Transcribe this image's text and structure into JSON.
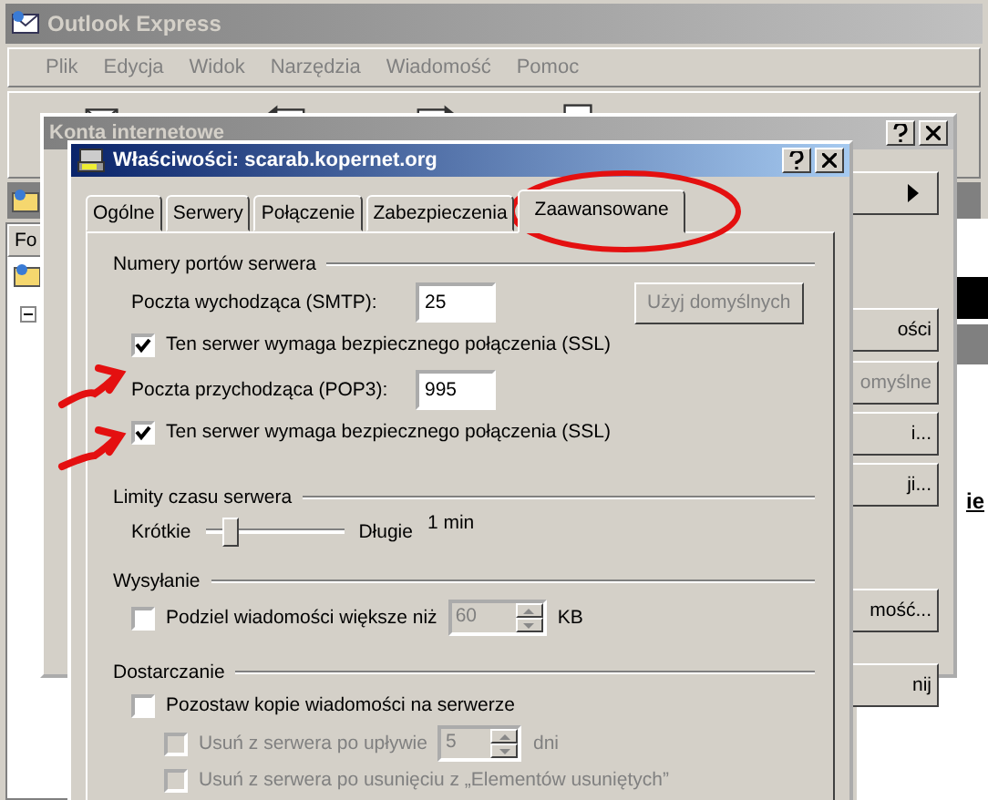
{
  "main_window": {
    "title": "Outlook Express",
    "menu": [
      "Plik",
      "Edycja",
      "Widok",
      "Narzędzia",
      "Wiadomość",
      "Pomoc"
    ],
    "folder_header": "Fo",
    "content_text": "ie"
  },
  "accounts_dialog": {
    "title": "Konta internetowe",
    "buttons": [
      {
        "label": "ości",
        "disabled": false
      },
      {
        "label": "omyślne",
        "disabled": true
      },
      {
        "label": "i...",
        "disabled": false
      },
      {
        "label": "ji...",
        "disabled": false
      },
      {
        "label": "mość...",
        "disabled": false
      },
      {
        "label": "nij",
        "disabled": false
      }
    ]
  },
  "properties_dialog": {
    "title": "Właściwości: scarab.kopernet.org",
    "tabs": [
      {
        "label": "Ogólne",
        "selected": false
      },
      {
        "label": "Serwery",
        "selected": false
      },
      {
        "label": "Połączenie",
        "selected": false
      },
      {
        "label": "Zabezpieczenia",
        "selected": false
      },
      {
        "label": "Zaawansowane",
        "selected": true
      }
    ],
    "ports": {
      "heading": "Numery portów serwera",
      "outgoing": {
        "label": "Poczta wychodząca (SMTP):",
        "value": "25"
      },
      "default_button": {
        "label": "Użyj domyślnych",
        "disabled": true
      },
      "outgoing_ssl": {
        "label": "Ten serwer wymaga bezpiecznego połączenia (SSL)",
        "checked": true
      },
      "incoming": {
        "label": "Poczta przychodząca (POP3):",
        "value": "995"
      },
      "incoming_ssl": {
        "label": "Ten serwer wymaga bezpiecznego połączenia (SSL)",
        "checked": true
      }
    },
    "timeouts": {
      "heading": "Limity czasu serwera",
      "min_label": "Krótkie",
      "max_label": "Długie",
      "level": 0.12,
      "reading": "1 min"
    },
    "sending": {
      "heading": "Wysyłanie",
      "split": {
        "label": "Podziel wiadomości większe niż",
        "checked": false,
        "value": "60",
        "value_disabled": true,
        "unit": "KB"
      }
    },
    "delivery": {
      "heading": "Dostarczanie",
      "leave_copy": {
        "label": "Pozostaw kopie wiadomości na serwerze",
        "checked": false,
        "disabled": false
      },
      "remove_after": {
        "label": "Usuń z serwera po upływie",
        "checked": false,
        "disabled": true,
        "value": "5",
        "unit": "dni"
      },
      "remove_deleted": {
        "label": "Usuń z serwera po usunięciu z „Elementów usuniętych”",
        "checked": false,
        "disabled": true
      }
    }
  }
}
